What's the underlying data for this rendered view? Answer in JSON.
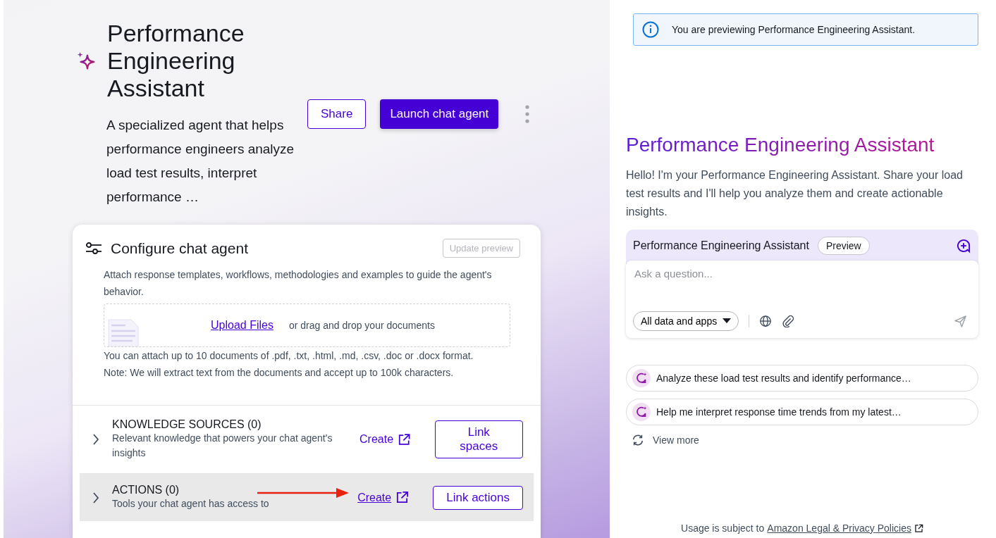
{
  "agent": {
    "title": "Performance Engineering Assistant",
    "description": "A specialized agent that helps performance engineers analyze load test results, interpret performance …",
    "share_button": "Share",
    "launch_button": "Launch chat agent"
  },
  "configure": {
    "title": "Configure chat agent",
    "update_button": {
      "label": "Update preview",
      "disabled": true
    },
    "intro": "Attach response templates, workflows, methodologies and examples to guide the agent's behavior.",
    "upload_link": "Upload Files",
    "upload_hint": "or drag and drop your documents",
    "notes": [
      "You can attach up to 10 documents of .pdf, .txt, .html, .md, .csv, .doc or .docx format.",
      "Note: We will extract text from the documents and accept up to 100k characters."
    ],
    "sections": [
      {
        "title": "KNOWLEDGE SOURCES (0)",
        "description": "Relevant knowledge that powers your chat agent's insights",
        "create_link": "Create",
        "button": "Link spaces",
        "highlighted": false,
        "annotated": false
      },
      {
        "title": "ACTIONS (0)",
        "description": "Tools your chat agent has access to",
        "create_link": "Create",
        "button": "Link actions",
        "highlighted": true,
        "annotated": true
      }
    ]
  },
  "preview": {
    "banner": "You are previewing Performance Engineering Assistant.",
    "heading": "Performance Engineering Assistant",
    "greeting": "Hello! I'm your Performance Engineering Assistant. Share your load test results and I'll help you analyze them and create actionable insights.",
    "chat": {
      "title": "Performance Engineering Assistant",
      "badge": "Preview",
      "placeholder": "Ask a question...",
      "scope": "All data and apps"
    },
    "suggestions": [
      "Analyze these load test results and identify performance…",
      "Help me interpret response time trends from my latest…"
    ],
    "view_more": "View more",
    "footer_text": "Usage is subject to",
    "footer_link": "Amazon Legal & Privacy Policies"
  }
}
